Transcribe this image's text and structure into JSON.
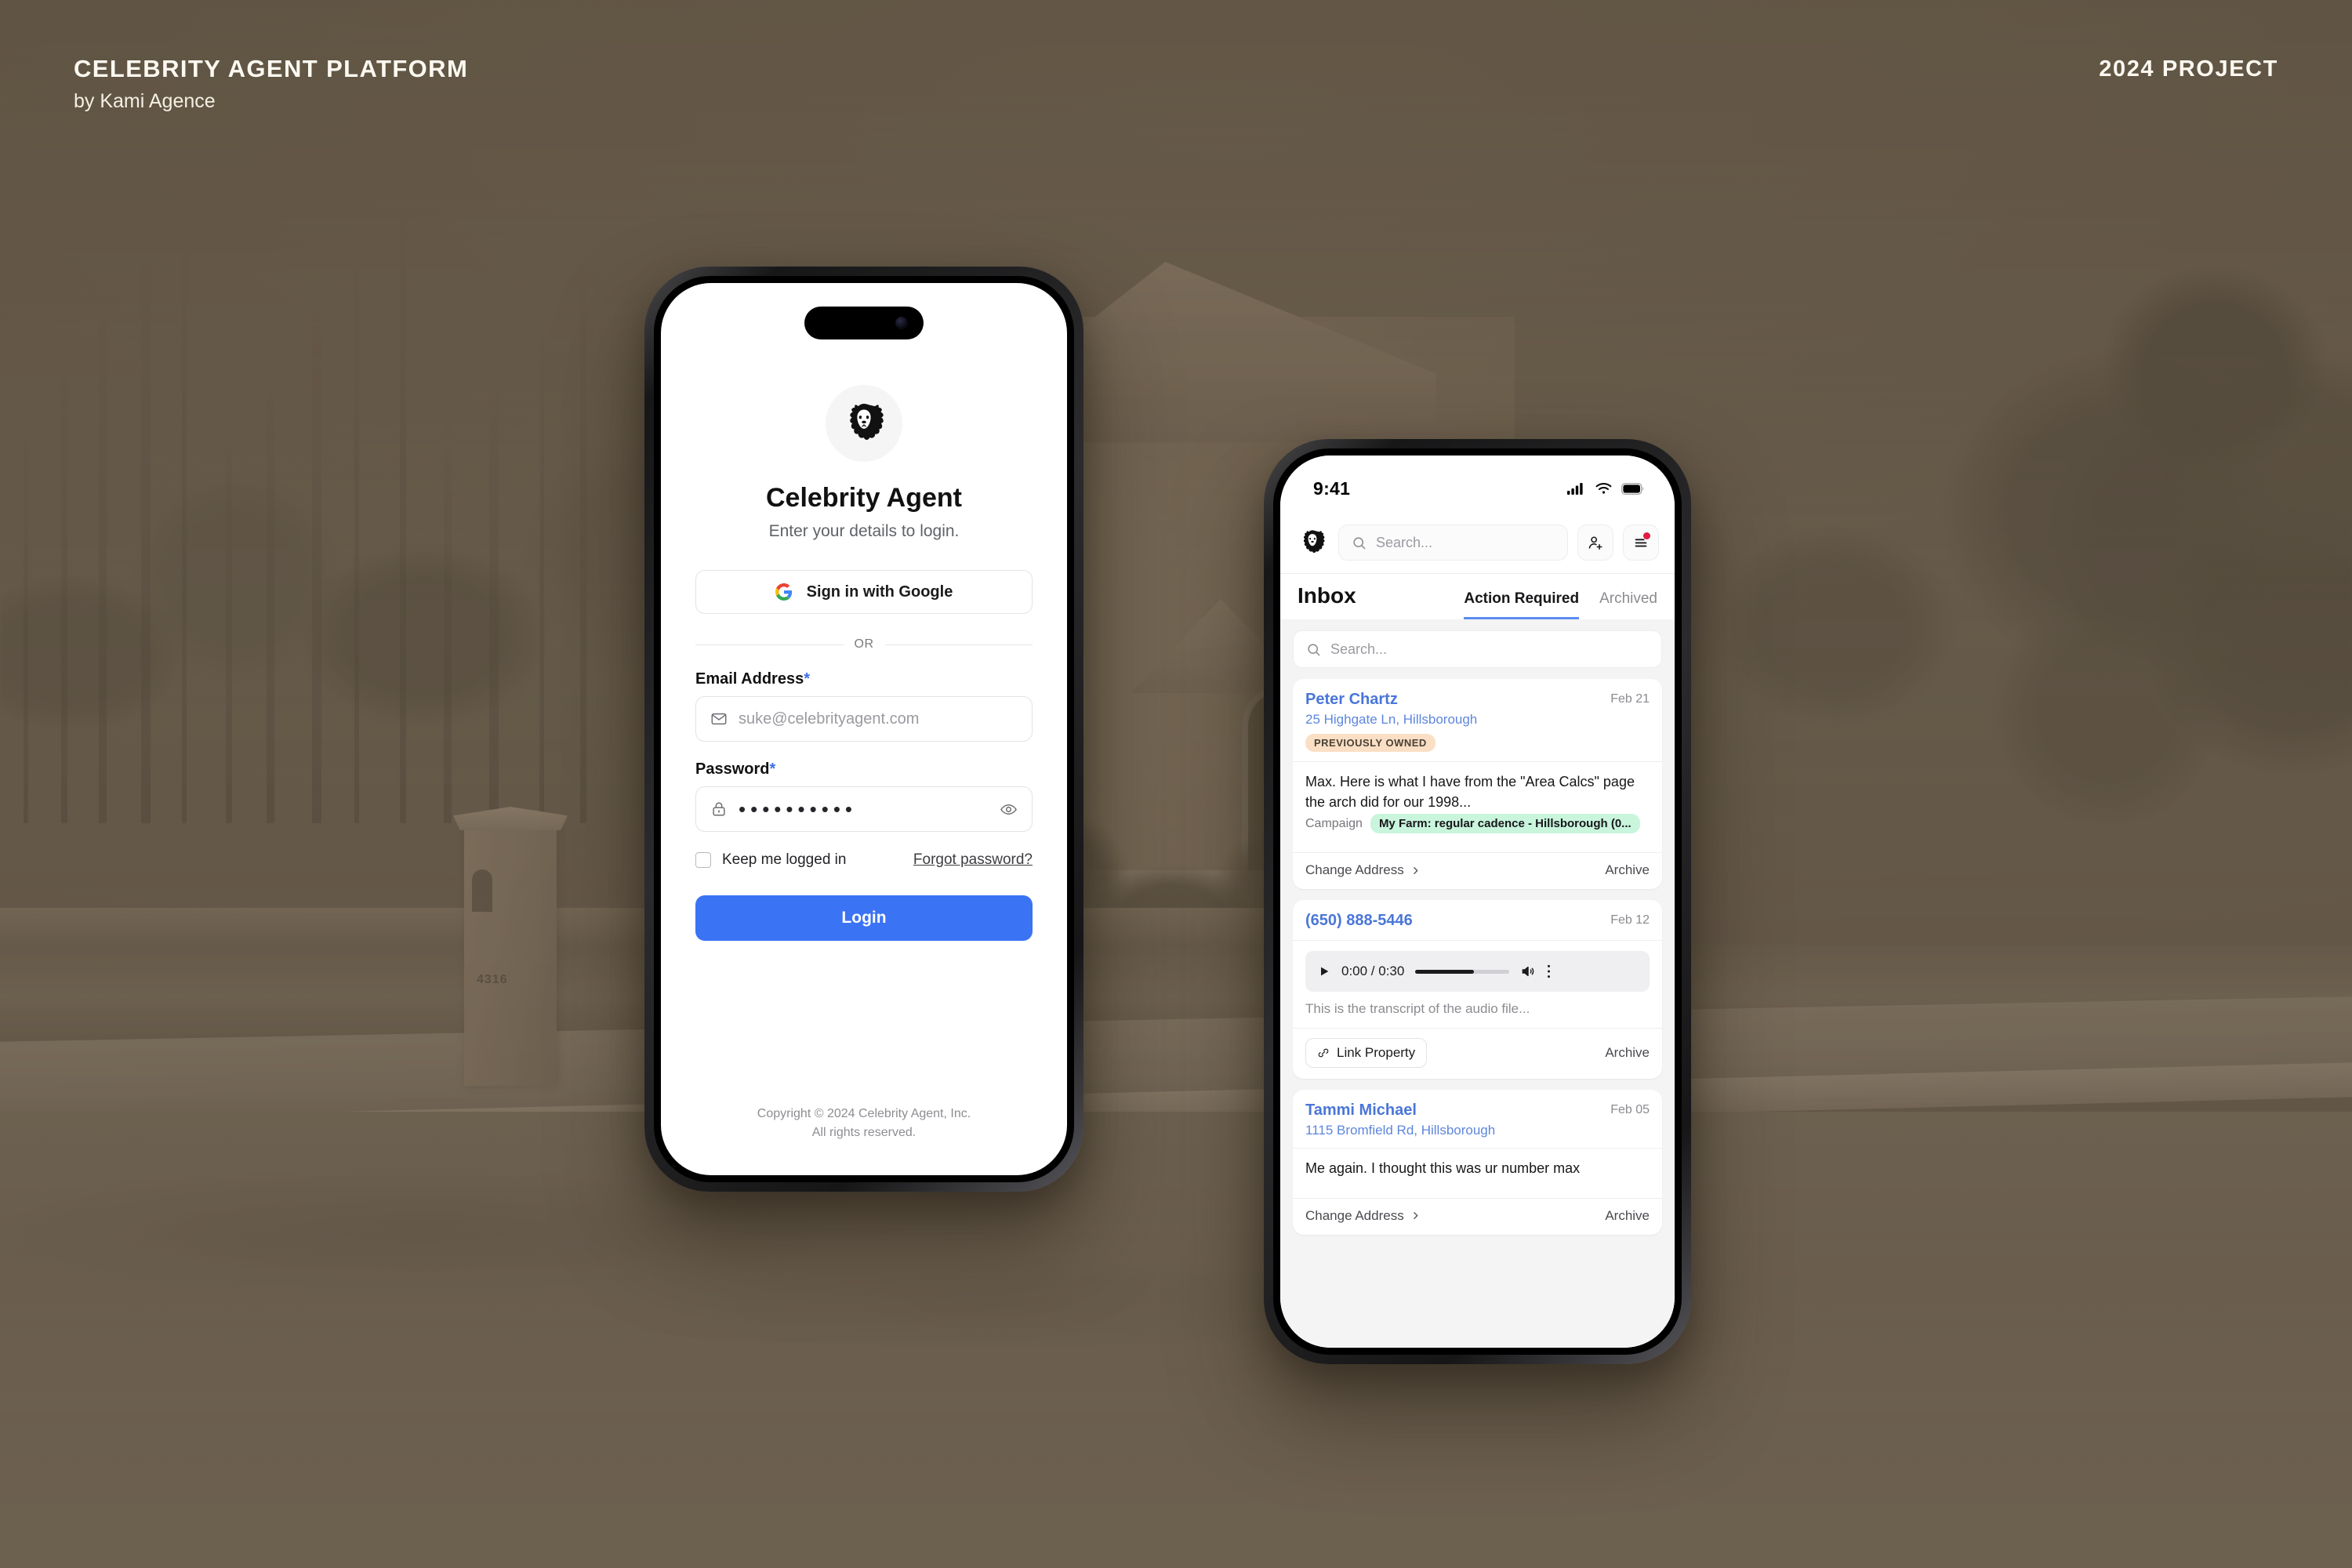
{
  "header": {
    "title": "CELEBRITY AGENT PLATFORM",
    "subtitle": "by Kami Agence",
    "right_label": "2024 PROJECT"
  },
  "colors": {
    "background": "#7b6f5f",
    "accent_blue": "#3b73f5",
    "link_blue": "#4a76d8",
    "tag_orange_bg": "#fbdfc4",
    "campaign_green_bg": "#c9f5dd",
    "notification_red": "#e01b3c"
  },
  "login_screen": {
    "logo_icon": "lion-head-icon",
    "app_title": "Celebrity Agent",
    "app_subtitle": "Enter your details to login.",
    "google_button": {
      "label": "Sign in with Google",
      "icon": "google-g-icon"
    },
    "divider_label": "OR",
    "email_field": {
      "label": "Email Address",
      "required_marker": "*",
      "placeholder": "suke@celebrityagent.com",
      "value": "",
      "icon": "envelope-icon"
    },
    "password_field": {
      "label": "Password",
      "required_marker": "*",
      "value": "••••••••••",
      "icon": "lock-icon",
      "toggle_icon": "eye-icon"
    },
    "keep_logged_in": {
      "label": "Keep me logged in",
      "checked": false
    },
    "forgot_password": "Forgot password?",
    "submit_button": "Login",
    "copyright_line1": "Copyright © 2024 Celebrity Agent, Inc.",
    "copyright_line2": "All rights reserved."
  },
  "inbox_screen": {
    "status_bar": {
      "time": "9:41",
      "icons": [
        "cellular-signal-icon",
        "wifi-icon",
        "battery-icon"
      ]
    },
    "top_bar": {
      "avatar_icon": "lion-head-avatar",
      "search_placeholder": "Search...",
      "search_icon": "search-icon",
      "add_contact_icon": "add-person-icon",
      "menu_icon": "filter-menu-icon",
      "menu_has_notification": true
    },
    "page_title": "Inbox",
    "tabs": [
      {
        "label": "Action Required",
        "active": true
      },
      {
        "label": "Archived",
        "active": false
      }
    ],
    "list_search_placeholder": "Search...",
    "messages": [
      {
        "type": "message",
        "name": "Peter Chartz",
        "address": "25 Highgate Ln, Hillsborough",
        "date": "Feb 21",
        "tag": "PREVIOUSLY OWNED",
        "body": "Max. Here is what I have from the \"Area Calcs\" page the arch did for our 1998...",
        "campaign_label": "Campaign",
        "campaign_value": "My Farm: regular cadence - Hillsborough (0...",
        "action_left": "Change Address",
        "action_left_icon": "chevron-right-icon",
        "action_right": "Archive"
      },
      {
        "type": "voicemail",
        "name": "(650) 888-5446",
        "date": "Feb 12",
        "audio": {
          "play_icon": "play-icon",
          "time": "0:00 / 0:30",
          "volume_icon": "volume-icon",
          "more_icon": "more-vertical-icon"
        },
        "transcript": "This is the transcript of the audio file...",
        "action_left": "Link Property",
        "action_left_icon": "link-icon",
        "action_right": "Archive"
      },
      {
        "type": "message",
        "name": "Tammi Michael",
        "address": "1115 Bromfield Rd, Hillsborough",
        "date": "Feb 05",
        "body": "Me again. I thought this was ur number max",
        "action_left": "Change Address",
        "action_left_icon": "chevron-right-icon",
        "action_right": "Archive"
      }
    ]
  }
}
